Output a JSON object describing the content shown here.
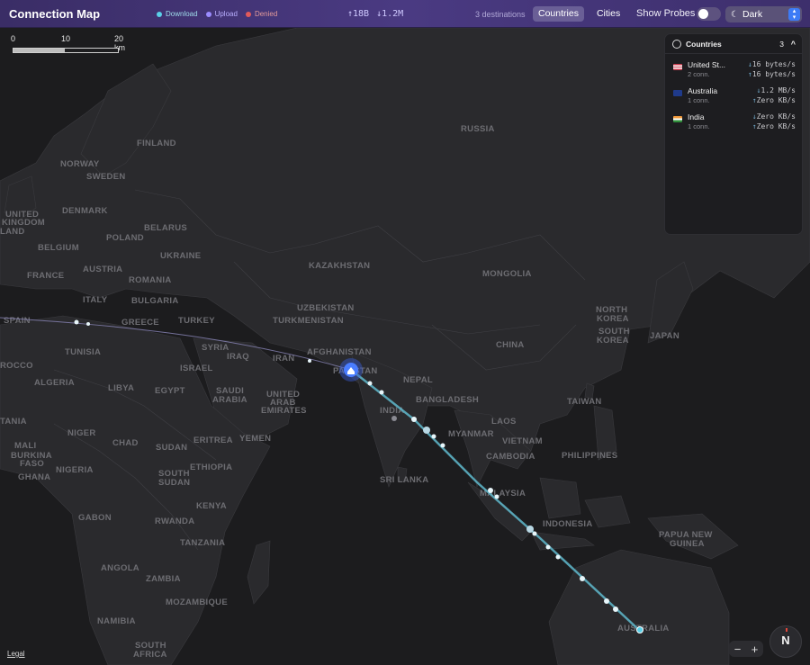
{
  "app": {
    "title": "Connection Map"
  },
  "legend": [
    {
      "label": "Download",
      "color": "#5ad0e8"
    },
    {
      "label": "Upload",
      "color": "#9b8cff"
    },
    {
      "label": "Denied",
      "color": "#e25a5a"
    }
  ],
  "rates": {
    "up": "↑18B",
    "down": "↓1.2M"
  },
  "destinations": "3 destinations",
  "view_toggle": {
    "active": "Countries",
    "inactive": "Cities"
  },
  "probes": {
    "label": "Show Probes"
  },
  "theme": {
    "value": "Dark"
  },
  "scale": {
    "labels": [
      "0",
      "10",
      "20 km"
    ]
  },
  "countries_panel": {
    "title": "Countries",
    "count": "3",
    "rows": [
      {
        "name": "United St...",
        "conn": "2 conn.",
        "down": "16 bytes/s",
        "up": "16 bytes/s"
      },
      {
        "name": "Australia",
        "conn": "1 conn.",
        "down": "1.2 MB/s",
        "up": "Zero KB/s"
      },
      {
        "name": "India",
        "conn": "1 conn.",
        "down": "Zero KB/s",
        "up": "Zero KB/s"
      }
    ]
  },
  "map_labels": [
    "RUSSIA",
    "FINLAND",
    "NORWAY",
    "SWEDEN",
    "DENMARK",
    "UNITED",
    "KINGDOM",
    "LAND",
    "BELARUS",
    "POLAND",
    "BELGIUM",
    "UKRAINE",
    "FRANCE",
    "AUSTRIA",
    "ROMANIA",
    "KAZAKHSTAN",
    "MONGOLIA",
    "ITALY",
    "BULGARIA",
    "UZBEKISTAN",
    "SPAIN",
    "GREECE",
    "TURKEY",
    "TURKMENISTAN",
    "NORTH",
    "KOREA",
    "SOUTH",
    "KOREA",
    "JAPAN",
    "CHINA",
    "TUNISIA",
    "SYRIA",
    "IRAQ",
    "IRAN",
    "AFGHANISTAN",
    "PAKISTAN",
    "ROCCO",
    "ISRAEL",
    "NEPAL",
    "ALGERIA",
    "LIBYA",
    "EGYPT",
    "SAUDI",
    "ARABIA",
    "UNITED",
    "ARAB",
    "EMIRATES",
    "INDIA",
    "BANGLADESH",
    "TAIWAN",
    "TANIA",
    "NIGER",
    "CHAD",
    "SUDAN",
    "ERITREA",
    "YEMEN",
    "MYANMAR",
    "LAOS",
    "VIETNAM",
    "MALI",
    "BURKINA",
    "FASO",
    "GHANA",
    "NIGERIA",
    "ETHIOPIA",
    "SOUTH",
    "SUDAN",
    "CAMBODIA",
    "PHILIPPINES",
    "SRI LANKA",
    "KENYA",
    "MALAYSIA",
    "GABON",
    "RWANDA",
    "INDONESIA",
    "TANZANIA",
    "PAPUA NEW",
    "GUINEA",
    "ANGOLA",
    "ZAMBIA",
    "MOZAMBIQUE",
    "NAMIBIA",
    "SOUTH",
    "AFRICA",
    "AUSTRALIA"
  ],
  "legal": "Legal",
  "zoom": {
    "out": "−",
    "in": "+"
  },
  "compass": "N",
  "colors": {
    "route": "#5fb8cc",
    "origin": "#4a7dff",
    "header": "#3f3170"
  }
}
